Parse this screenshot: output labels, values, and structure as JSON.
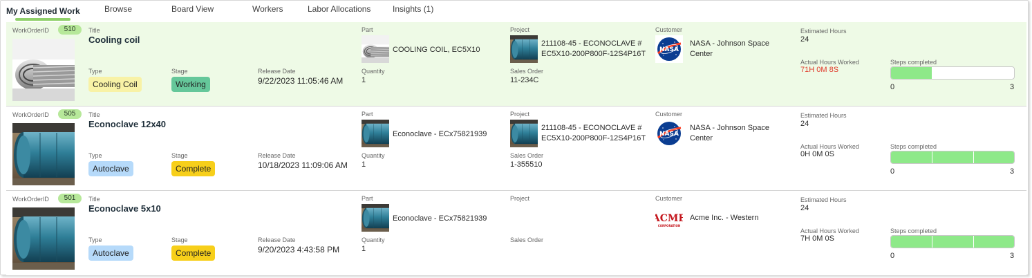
{
  "tabs": [
    {
      "label": "My Assigned Work"
    },
    {
      "label": "Browse"
    },
    {
      "label": "Board View"
    },
    {
      "label": "Workers"
    },
    {
      "label": "Labor Allocations"
    },
    {
      "label": "Insights (1)"
    }
  ],
  "labels": {
    "work_order_id": "WorkOrderID",
    "title": "Title",
    "type": "Type",
    "stage": "Stage",
    "release_date": "Release Date",
    "part": "Part",
    "quantity": "Quantity",
    "project": "Project",
    "sales_order": "Sales Order",
    "customer": "Customer",
    "estimated_hours": "Estimated Hours",
    "actual_hours": "Actual Hours Worked",
    "steps_completed": "Steps completed"
  },
  "orders": [
    {
      "id": "510",
      "title": "Cooling coil",
      "type": "Cooling Coil",
      "stage": "Working",
      "release_date": "9/22/2023 11:05:46 AM",
      "part": "COOLING COIL, EC5X10",
      "quantity": "1",
      "project_line1": "211108-45 - ECONOCLAVE #",
      "project_line2": "EC5X10-200P800F-12S4P16T",
      "sales_order": "11-234C",
      "customer_line1": "NASA - Johnson Space",
      "customer_line2": "Center",
      "customer_logo": "nasa-logo",
      "estimated_hours": "24",
      "actual_hours": "71H 0M 8S",
      "actual_hours_color": "#e0392a",
      "steps_min": "0",
      "steps_max": "3",
      "steps_done": 1,
      "steps_total": 3
    },
    {
      "id": "505",
      "title": "Econoclave 12x40",
      "type": "Autoclave",
      "stage": "Complete",
      "release_date": "10/18/2023 11:09:06 AM",
      "part": "Econoclave - ECx75821939",
      "quantity": "1",
      "project_line1": "211108-45 - ECONOCLAVE #",
      "project_line2": "EC5X10-200P800F-12S4P16T",
      "sales_order": "1-355510",
      "customer_line1": "NASA - Johnson Space",
      "customer_line2": "Center",
      "customer_logo": "nasa-logo",
      "estimated_hours": "24",
      "actual_hours": "0H 0M 0S",
      "steps_min": "0",
      "steps_max": "3",
      "steps_done": 3,
      "steps_total": 3
    },
    {
      "id": "501",
      "title": "Econoclave 5x10",
      "type": "Autoclave",
      "stage": "Complete",
      "release_date": "9/20/2023 4:43:58 PM",
      "part": "Econoclave - ECx75821939",
      "quantity": "1",
      "project_line1": "",
      "project_line2": "",
      "sales_order": "",
      "customer_line1": "Acme Inc. - Western",
      "customer_line2": "",
      "customer_logo": "acme-logo",
      "customer_logo_text": "ACME",
      "customer_logo_subtext": "CORPORATION",
      "estimated_hours": "24",
      "actual_hours": "7H 0M 0S",
      "steps_min": "0",
      "steps_max": "3",
      "steps_done": 3,
      "steps_total": 3
    }
  ],
  "colors": {
    "highlight_row": "#eefae6",
    "progress_fill": "#8ee989",
    "tab_underline": "#8fd06a",
    "working": "#65c79a",
    "complete": "#f7cf1a",
    "cooling_coil": "#f8f2a6",
    "autoclave": "#b6dafa"
  }
}
